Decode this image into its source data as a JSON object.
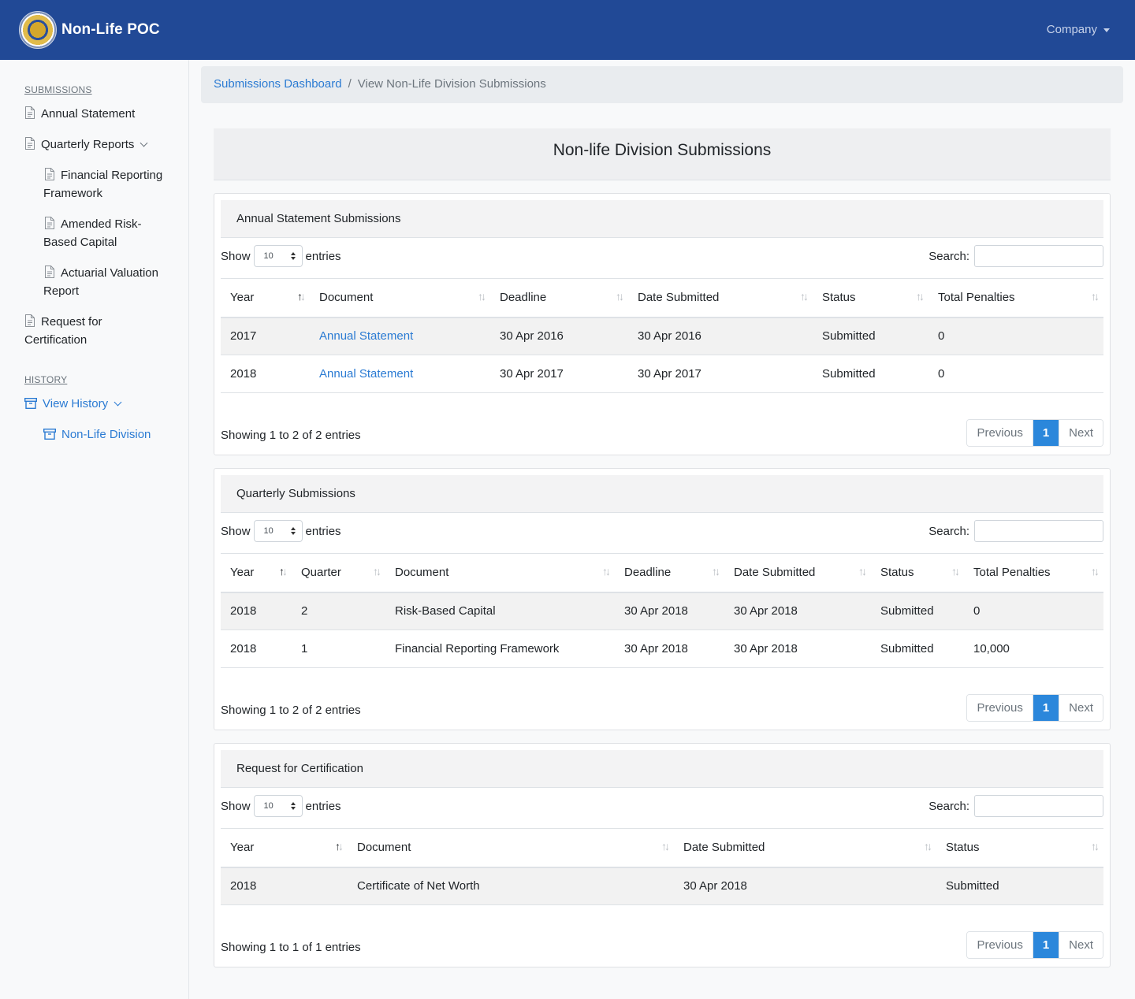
{
  "navbar": {
    "brand": "Non-Life POC",
    "logo_text": "INSURANCE COMMISSION 1949",
    "company_label": "Company"
  },
  "sidebar": {
    "submissions_heading": "SUBMISSIONS",
    "annual_statement": "Annual Statement",
    "quarterly_reports": "Quarterly Reports",
    "financial_reporting_1": "Financial Reporting",
    "financial_reporting_2": "Framework",
    "amended_1": "Amended Risk-",
    "amended_2": "Based Capital",
    "actuarial_1": "Actuarial Valuation",
    "actuarial_2": "Report",
    "request_1": "Request for",
    "request_2": "Certification",
    "history_heading": "HISTORY",
    "view_history": "View History",
    "non_life_division": "Non-Life Division"
  },
  "breadcrumb": {
    "home": "Submissions Dashboard",
    "separator": "/",
    "current": "View Non-Life Division Submissions"
  },
  "page_title": "Non-life Division Submissions",
  "common": {
    "show": "Show",
    "entries": "entries",
    "search": "Search:",
    "length_value": "10",
    "previous": "Previous",
    "page": "1",
    "next": "Next"
  },
  "annual": {
    "title": "Annual Statement Submissions",
    "headers": [
      "Year",
      "Document",
      "Deadline",
      "Date Submitted",
      "Status",
      "Total Penalties"
    ],
    "rows": [
      [
        "2017",
        "Annual Statement",
        "30 Apr 2016",
        "30 Apr 2016",
        "Submitted",
        "0"
      ],
      [
        "2018",
        "Annual Statement",
        "30 Apr 2017",
        "30 Apr 2017",
        "Submitted",
        "0"
      ]
    ],
    "info": "Showing 1 to 2 of 2 entries"
  },
  "quarterly": {
    "title": "Quarterly Submissions",
    "headers": [
      "Year",
      "Quarter",
      "Document",
      "Deadline",
      "Date Submitted",
      "Status",
      "Total Penalties"
    ],
    "rows": [
      [
        "2018",
        "2",
        "Risk-Based Capital",
        "30 Apr 2018",
        "30 Apr 2018",
        "Submitted",
        "0"
      ],
      [
        "2018",
        "1",
        "Financial Reporting Framework",
        "30 Apr 2018",
        "30 Apr 2018",
        "Submitted",
        "10,000"
      ]
    ],
    "info": "Showing 1 to 2 of 2 entries"
  },
  "certification": {
    "title": "Request for Certification",
    "headers": [
      "Year",
      "Document",
      "Date Submitted",
      "Status"
    ],
    "rows": [
      [
        "2018",
        "Certificate of Net Worth",
        "30 Apr 2018",
        "Submitted"
      ]
    ],
    "info": "Showing 1 to 1 of 1 entries"
  }
}
